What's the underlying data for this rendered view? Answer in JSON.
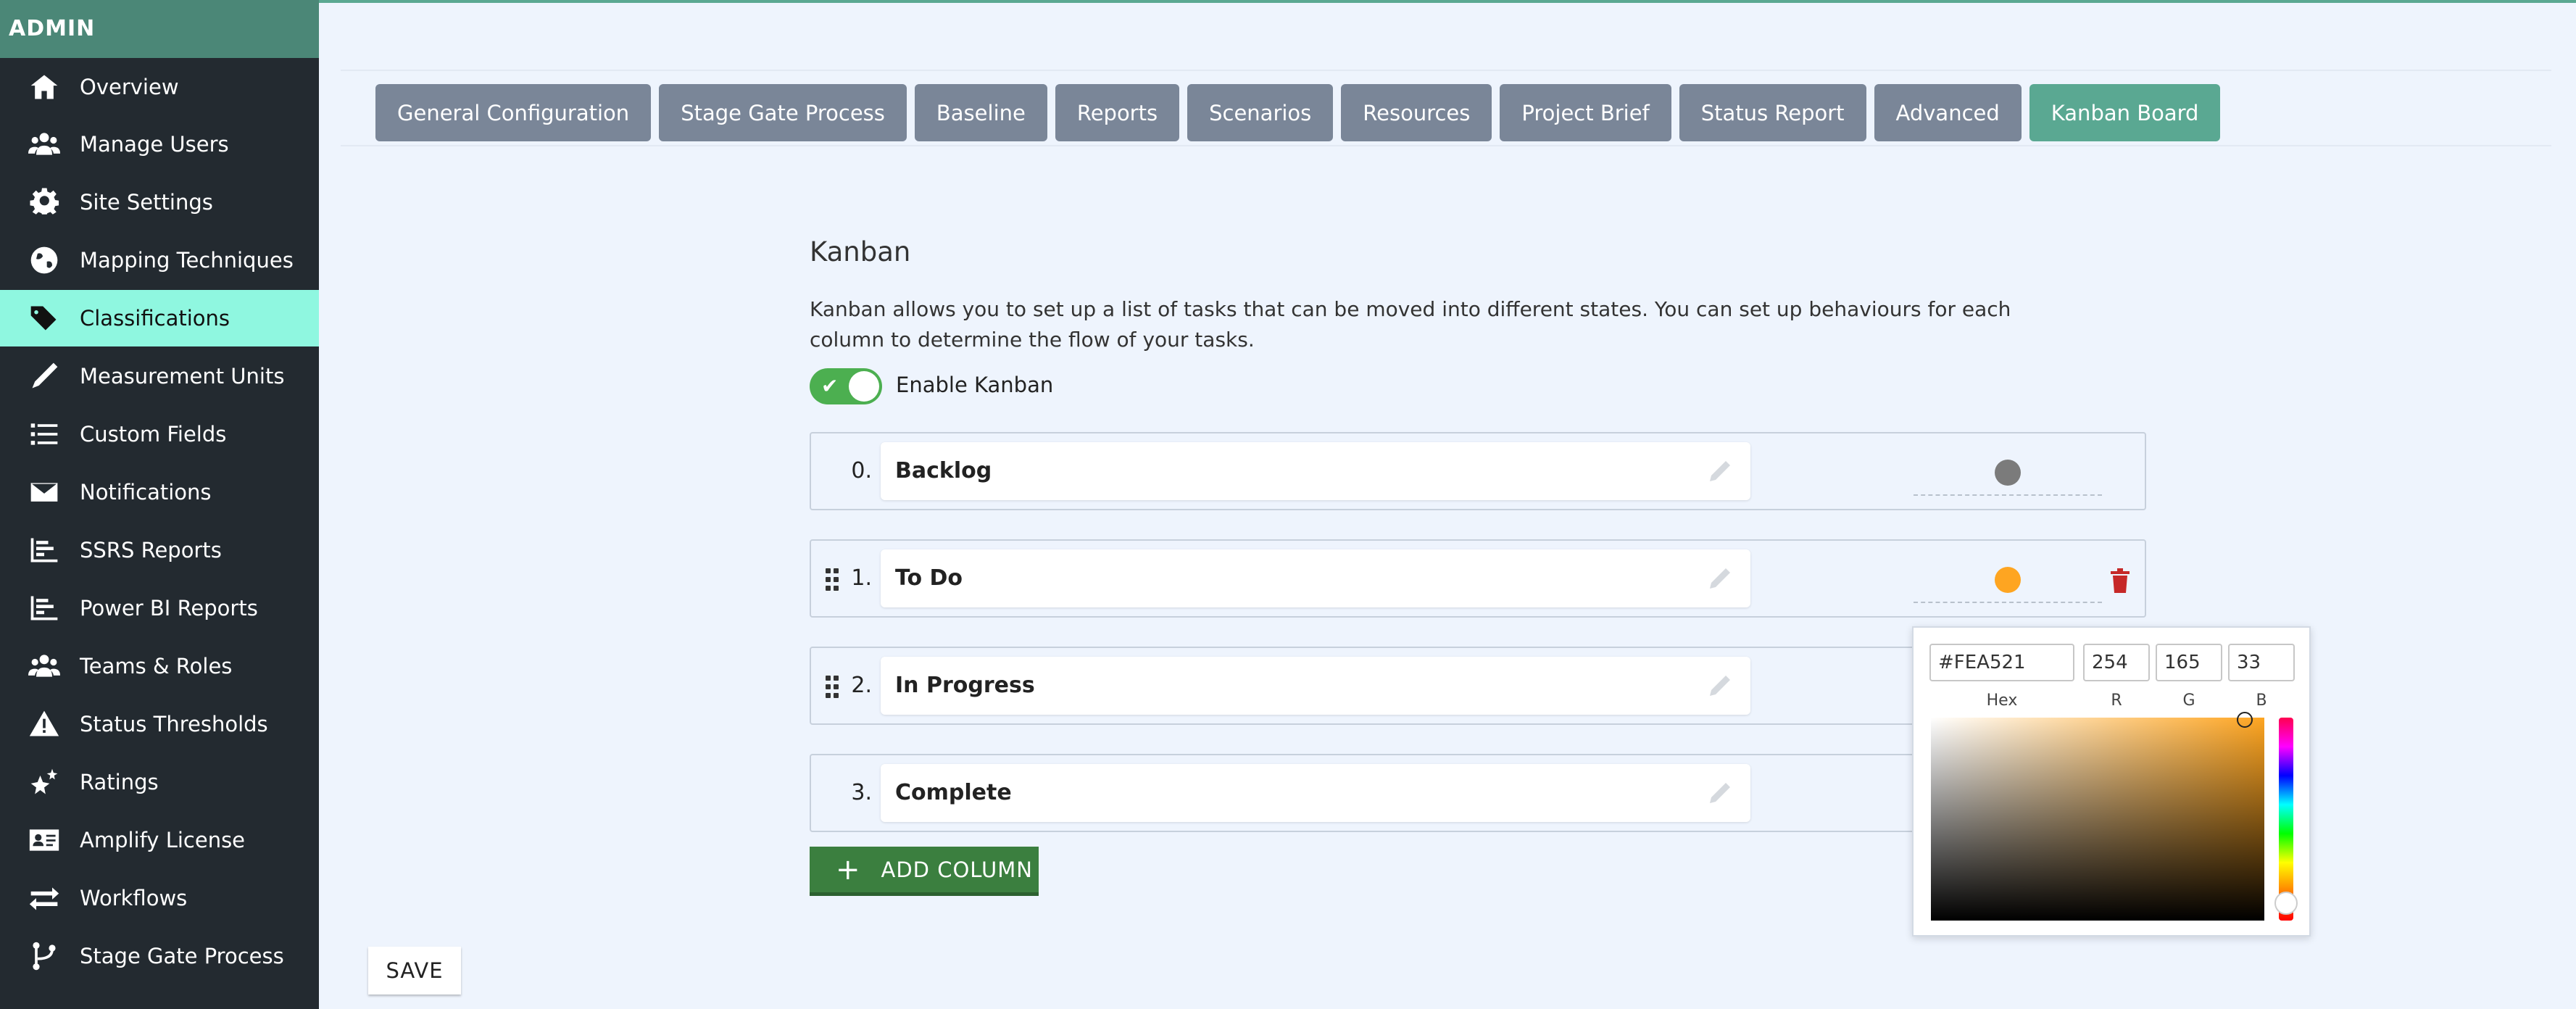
{
  "sidebar": {
    "header": "ADMIN",
    "items": [
      {
        "label": "Overview",
        "icon": "home-icon"
      },
      {
        "label": "Manage Users",
        "icon": "users-icon"
      },
      {
        "label": "Site Settings",
        "icon": "gear-icon"
      },
      {
        "label": "Mapping Techniques",
        "icon": "globe-icon"
      },
      {
        "label": "Classifications",
        "icon": "tags-icon",
        "active": true
      },
      {
        "label": "Measurement Units",
        "icon": "ruler-pen-icon"
      },
      {
        "label": "Custom Fields",
        "icon": "list-icon"
      },
      {
        "label": "Notifications",
        "icon": "envelope-icon"
      },
      {
        "label": "SSRS Reports",
        "icon": "bar-chart-icon"
      },
      {
        "label": "Power BI Reports",
        "icon": "bar-chart-icon"
      },
      {
        "label": "Teams & Roles",
        "icon": "users-icon"
      },
      {
        "label": "Status Thresholds",
        "icon": "warning-icon"
      },
      {
        "label": "Ratings",
        "icon": "stars-icon"
      },
      {
        "label": "Amplify License",
        "icon": "id-card-icon"
      },
      {
        "label": "Workflows",
        "icon": "arrows-exchange-icon"
      },
      {
        "label": "Stage Gate Process",
        "icon": "branch-icon"
      }
    ]
  },
  "tabs": [
    {
      "label": "General Configuration"
    },
    {
      "label": "Stage Gate Process"
    },
    {
      "label": "Baseline"
    },
    {
      "label": "Reports"
    },
    {
      "label": "Scenarios"
    },
    {
      "label": "Resources"
    },
    {
      "label": "Project Brief"
    },
    {
      "label": "Status Report"
    },
    {
      "label": "Advanced"
    },
    {
      "label": "Kanban Board",
      "active": true
    }
  ],
  "kanban": {
    "title": "Kanban",
    "description": "Kanban allows you to set up a list of tasks that can be moved into different states. You can set up behaviours for each column to determine the flow of your tasks.",
    "enable_label": "Enable Kanban",
    "enabled": true,
    "columns": [
      {
        "num": "0.",
        "label": "Backlog",
        "color": "#7b7b7b",
        "draggable": false,
        "deletable": false
      },
      {
        "num": "1.",
        "label": "To Do",
        "color": "#fea521",
        "draggable": true,
        "deletable": true
      },
      {
        "num": "2.",
        "label": "In Progress",
        "color": "#fea521",
        "draggable": true,
        "deletable": false
      },
      {
        "num": "3.",
        "label": "Complete",
        "color": "#4caf50",
        "draggable": false,
        "deletable": false
      }
    ],
    "add_column_label": "ADD COLUMN"
  },
  "picker": {
    "hex": "#FEA521",
    "r": "254",
    "g": "165",
    "b": "33",
    "labels": {
      "hex": "Hex",
      "r": "R",
      "g": "G",
      "b": "B"
    }
  },
  "save_label": "SAVE",
  "colors": {
    "accent": "#5aa892",
    "sidebar_bg": "#232a30",
    "active_item": "#8ff7e0",
    "tab_bg": "#7a8698",
    "add_button": "#3b7f3f",
    "delete": "#c62828"
  }
}
